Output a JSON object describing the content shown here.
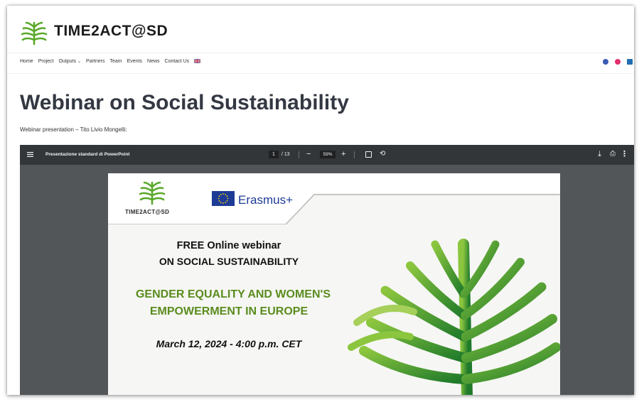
{
  "site": {
    "title": "TIME2ACT@SD"
  },
  "nav": {
    "items": [
      {
        "label": "Home"
      },
      {
        "label": "Project"
      },
      {
        "label": "Outputs",
        "has_dropdown": true
      },
      {
        "label": "Partners"
      },
      {
        "label": "Team"
      },
      {
        "label": "Events"
      },
      {
        "label": "News"
      },
      {
        "label": "Contact Us"
      }
    ],
    "language_flag": "uk-flag-icon",
    "social_icons": [
      "facebook-icon",
      "instagram-icon",
      "linkedin-icon"
    ]
  },
  "page": {
    "title": "Webinar on Social Sustainability",
    "subtitle": "Webinar presentation – Tito Livio Mongelli:"
  },
  "viewer": {
    "doc_title": "Presentazione standard di PowerPoint",
    "page_current": "1",
    "page_total": "/ 13",
    "zoom": "59%",
    "progress_page": 1,
    "page_count": 13
  },
  "slide": {
    "logo_text": "TIME2ACT@SD",
    "program": "Erasmus+",
    "line1": "FREE Online webinar",
    "line2": "ON SOCIAL SUSTAINABILITY",
    "line3": "GENDER EQUALITY AND WOMEN'S",
    "line4": "EMPOWERMENT IN EUROPE",
    "date": "March 12, 2024 - 4:00 p.m. CET"
  },
  "colors": {
    "viewer_bg": "#525659",
    "toolbar_bg": "#323639",
    "brand_green": "#5a8c1e",
    "eu_blue": "#1e3c96",
    "title_text": "#333842"
  }
}
